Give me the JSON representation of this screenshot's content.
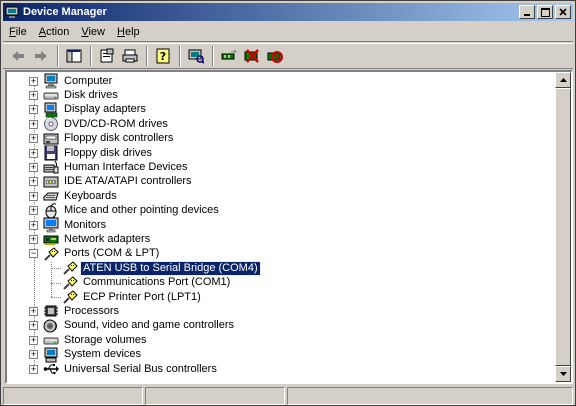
{
  "window": {
    "title": "Device Manager"
  },
  "menu": [
    "File",
    "Action",
    "View",
    "Help"
  ],
  "menu_underline": [
    "F",
    "A",
    "V",
    "H"
  ],
  "toolbar": [
    "back",
    "forward",
    "show-hide-console",
    "properties",
    "print",
    "help",
    "scan-hardware",
    "update-driver",
    "uninstall",
    "disable"
  ],
  "tree": [
    {
      "label": "Computer",
      "icon": "computer-icon",
      "expanded": false
    },
    {
      "label": "Disk drives",
      "icon": "disk-drive-icon",
      "expanded": false
    },
    {
      "label": "Display adapters",
      "icon": "display-adapter-icon",
      "expanded": false
    },
    {
      "label": "DVD/CD-ROM drives",
      "icon": "cdrom-icon",
      "expanded": false
    },
    {
      "label": "Floppy disk controllers",
      "icon": "floppy-controller-icon",
      "expanded": false
    },
    {
      "label": "Floppy disk drives",
      "icon": "floppy-drive-icon",
      "expanded": false
    },
    {
      "label": "Human Interface Devices",
      "icon": "hid-icon",
      "expanded": false
    },
    {
      "label": "IDE ATA/ATAPI controllers",
      "icon": "ide-controller-icon",
      "expanded": false
    },
    {
      "label": "Keyboards",
      "icon": "keyboard-icon",
      "expanded": false
    },
    {
      "label": "Mice and other pointing devices",
      "icon": "mouse-icon",
      "expanded": false
    },
    {
      "label": "Monitors",
      "icon": "monitor-icon",
      "expanded": false
    },
    {
      "label": "Network adapters",
      "icon": "network-adapter-icon",
      "expanded": false
    },
    {
      "label": "Ports (COM & LPT)",
      "icon": "port-icon",
      "expanded": true,
      "children": [
        {
          "label": "ATEN USB to Serial Bridge (COM4)",
          "icon": "port-icon",
          "selected": true
        },
        {
          "label": "Communications Port (COM1)",
          "icon": "port-icon"
        },
        {
          "label": "ECP Printer Port (LPT1)",
          "icon": "port-icon"
        }
      ]
    },
    {
      "label": "Processors",
      "icon": "processor-icon",
      "expanded": false
    },
    {
      "label": "Sound, video and game controllers",
      "icon": "sound-icon",
      "expanded": false
    },
    {
      "label": "Storage volumes",
      "icon": "storage-volume-icon",
      "expanded": false
    },
    {
      "label": "System devices",
      "icon": "system-device-icon",
      "expanded": false
    },
    {
      "label": "Universal Serial Bus controllers",
      "icon": "usb-icon",
      "expanded": false
    }
  ]
}
